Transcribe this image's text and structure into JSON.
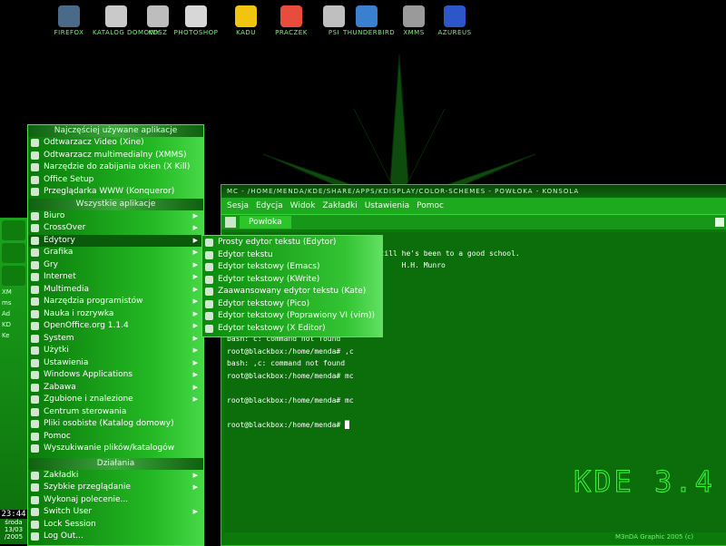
{
  "desktop": {
    "icons": [
      {
        "label": "FIREFOX",
        "icon": "firefox-icon",
        "color": "#4a6a8a"
      },
      {
        "label": "KATALOG DOMOWY",
        "icon": "home-folder-icon",
        "color": "#c9c9c9"
      },
      {
        "label": "KOSZ",
        "icon": "trash-icon",
        "color": "#bdbdbd"
      },
      {
        "label": "PHOTOSHOP",
        "icon": "photoshop-icon",
        "color": "#d7d7d7"
      },
      {
        "label": "KADU",
        "icon": "sun-icon",
        "color": "#f1c40f"
      },
      {
        "label": "PRACZEK",
        "icon": "calendar-icon",
        "color": "#e74c3c"
      },
      {
        "label": "PSI",
        "icon": "psi-icon",
        "color": "#bfbfbf"
      },
      {
        "label": "THUNDERBIRD",
        "icon": "thunderbird-icon",
        "color": "#3b7fcf"
      },
      {
        "label": "XMMS",
        "icon": "xmms-icon",
        "color": "#9a9a9a"
      },
      {
        "label": "AZUREUS",
        "icon": "azureus-icon",
        "color": "#2c56c9"
      }
    ],
    "kde_logo": "KDE 3.4",
    "credit": "M3nDA Graphic 2005 (c)"
  },
  "panel": {
    "tasks": [
      "XM",
      "ms",
      "Ad",
      "KD",
      "Ke"
    ],
    "clock": {
      "time": "23:44",
      "day": "środa",
      "date": "13/03",
      "year": "/2005"
    }
  },
  "konsole": {
    "title": "MC - /HOME/MENDA/KDE/SHARE/APPS/KDISPLAY/COLOR-SCHEMES - POWŁOKA - KONSOLA",
    "menu": [
      "Sesja",
      "Edycja",
      "Widok",
      "Zakładki",
      "Ustawienia",
      "Pomoc"
    ],
    "tab": "Powłoka",
    "lines": [
      "",
      "                     to be vicious till he's been to a good school.",
      "                                        H.H. Munro",
      "",
      "",
      "",
      "",
      "",
      "bash: c: command not found",
      "root@blackbox:/home/menda# ,c",
      "bash: ,c: command not found",
      "root@blackbox:/home/menda# mc",
      "",
      "root@blackbox:/home/menda# mc",
      "",
      "root@blackbox:/home/menda# █"
    ]
  },
  "kmenu": {
    "section_recent": "Najczęściej używane aplikacje",
    "recent": [
      "Odtwarzacz Video (Xine)",
      "Odtwarzacz multimedialny (XMMS)",
      "Narzędzie do zabijania okien (X Kill)",
      "Office Setup",
      "Przeglądarka WWW (Konqueror)"
    ],
    "section_all": "Wszystkie aplikacje",
    "all": [
      {
        "label": "Biuro",
        "sub": true
      },
      {
        "label": "CrossOver",
        "sub": true
      },
      {
        "label": "Edytory",
        "sub": true,
        "selected": true
      },
      {
        "label": "Grafika",
        "sub": true
      },
      {
        "label": "Gry",
        "sub": true
      },
      {
        "label": "Internet",
        "sub": true
      },
      {
        "label": "Multimedia",
        "sub": true
      },
      {
        "label": "Narzędzia programistów",
        "sub": true
      },
      {
        "label": "Nauka i rozrywka",
        "sub": true
      },
      {
        "label": "OpenOffice.org 1.1.4",
        "sub": true
      },
      {
        "label": "System",
        "sub": true
      },
      {
        "label": "Użytki",
        "sub": true
      },
      {
        "label": "Ustawienia",
        "sub": true
      },
      {
        "label": "Windows Applications",
        "sub": true
      },
      {
        "label": "Zabawa",
        "sub": true
      },
      {
        "label": "Zgubione i znalezione",
        "sub": true
      },
      {
        "label": "Centrum sterowania",
        "sub": false
      },
      {
        "label": "Pliki osobiste (Katalog domowy)",
        "sub": false
      },
      {
        "label": "Pomoc",
        "sub": false
      },
      {
        "label": "Wyszukiwanie plików/katalogów",
        "sub": false
      }
    ],
    "section_actions": "Działania",
    "actions": [
      {
        "label": "Zakładki",
        "sub": true
      },
      {
        "label": "Szybkie przeglądanie",
        "sub": true
      },
      {
        "label": "Wykonaj polecenie...",
        "sub": false
      },
      {
        "label": "Switch User",
        "sub": true
      },
      {
        "label": "Lock Session",
        "sub": false
      },
      {
        "label": "Log Out...",
        "sub": false
      }
    ]
  },
  "submenu": [
    "Prosty edytor tekstu (Edytor)",
    "Edytor tekstu",
    "Edytor tekstowy (Emacs)",
    "Edytor tekstowy (KWrite)",
    "Zaawansowany edytor tekstu (Kate)",
    "Edytor tekstowy (Pico)",
    "Edytor tekstowy (Poprawiony VI (vim))",
    "Edytor tekstowy (X Editor)"
  ]
}
